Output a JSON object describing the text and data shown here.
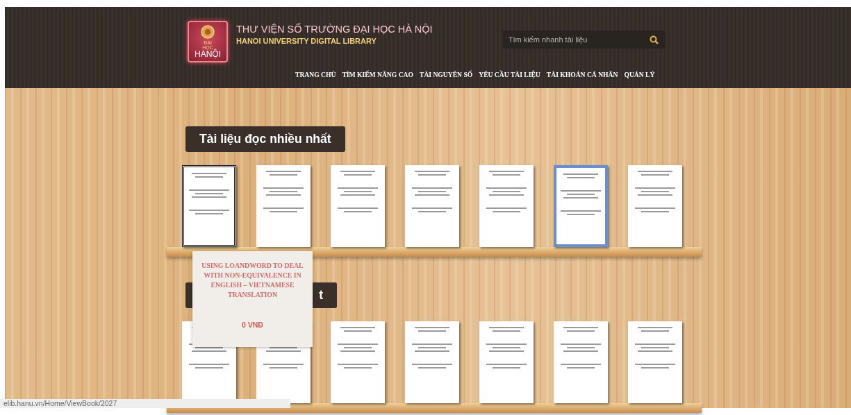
{
  "logo": {
    "lines": [
      "ĐẠI",
      "HỌC",
      "HANỘI"
    ]
  },
  "site": {
    "title": "THƯ VIỆN SỐ TRƯỜNG ĐẠI HỌC HÀ NỘI",
    "subtitle": "HANOI UNIVERSITY DIGITAL LIBRARY"
  },
  "search": {
    "placeholder": "Tìm kiếm nhanh tài liệu"
  },
  "nav": [
    "TRANG CHỦ",
    "TÌM KIẾM NÂNG CAO",
    "TÀI NGUYÊN SỐ",
    "YÊU CẦU TÀI LIỆU",
    "TÀI KHOẢN CÁ NHÂN",
    "QUẢN LÝ"
  ],
  "shelves": [
    {
      "title": "Tài liệu đọc nhiều nhất",
      "books": [
        {
          "kind": "framed"
        },
        {
          "kind": "plain"
        },
        {
          "kind": "plain"
        },
        {
          "kind": "plain"
        },
        {
          "kind": "plain"
        },
        {
          "kind": "ornate"
        },
        {
          "kind": "plain"
        }
      ]
    },
    {
      "title": "t",
      "books": [
        {
          "kind": "plain"
        },
        {
          "kind": "plain"
        },
        {
          "kind": "plain"
        },
        {
          "kind": "plain"
        },
        {
          "kind": "plain"
        },
        {
          "kind": "plain"
        },
        {
          "kind": "plain"
        }
      ]
    }
  ],
  "tooltip": {
    "title": "USING LOANDWORD TO DEAL WITH NON-EQUIVALENCE IN ENGLISH – VIETNAMESE TRANSLATION",
    "price": "0 VNĐ"
  },
  "status_bar": {
    "url": "elib.hanu.vn/Home/ViewBook/2027"
  }
}
